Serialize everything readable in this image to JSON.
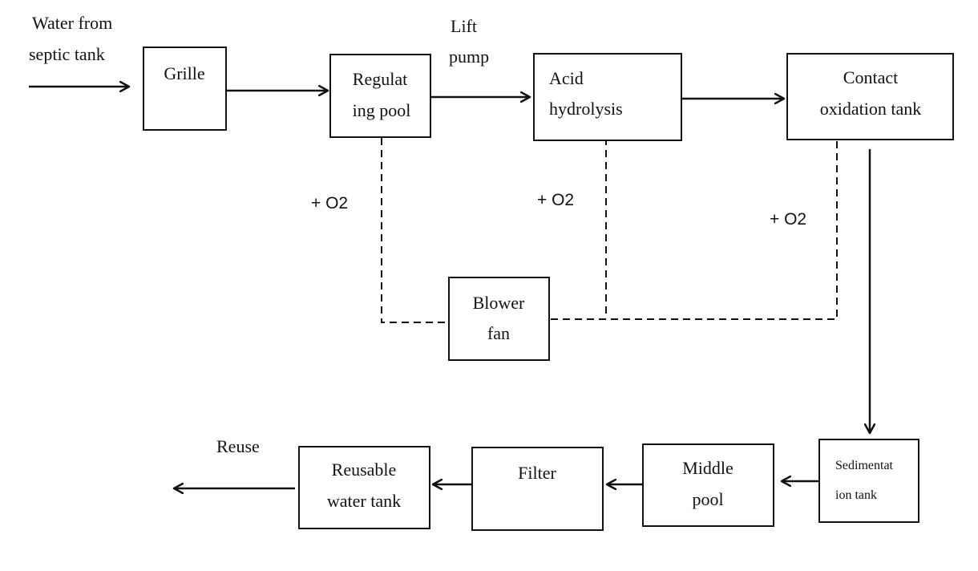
{
  "labels": {
    "input_1": "Water from",
    "input_2": "septic tank",
    "lift_1": "Lift",
    "lift_2": "pump",
    "o2_1": "+ O2",
    "o2_2": "+ O2",
    "o2_3": "+ O2",
    "reuse": "Reuse"
  },
  "boxes": {
    "grille": [
      "Grille"
    ],
    "regulating_pool": [
      "Regulat",
      "ing pool"
    ],
    "acid_hydrolysis": [
      "Acid",
      "hydrolysis"
    ],
    "contact_oxidation": [
      "Contact",
      "oxidation tank"
    ],
    "blower_fan": [
      "Blower",
      "fan"
    ],
    "sedimentation": [
      "Sedimentat",
      "ion tank"
    ],
    "middle_pool": [
      "Middle",
      "pool"
    ],
    "filter": [
      "Filter"
    ],
    "reusable_tank": [
      "Reusable",
      "water tank"
    ]
  }
}
